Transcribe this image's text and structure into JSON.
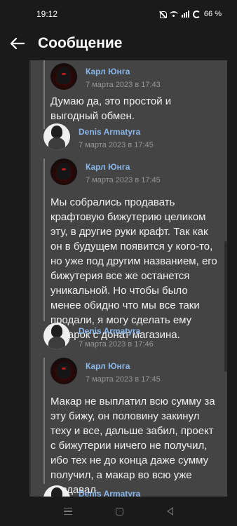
{
  "status_bar": {
    "time": "19:12",
    "battery": "66 %",
    "icons": [
      "bell-off-icon",
      "wifi-icon",
      "signal-icon",
      "battery-icon"
    ]
  },
  "header": {
    "title": "Сообщение",
    "back_icon": "arrow-left-icon"
  },
  "messages": [
    {
      "author": "Карл Юнга",
      "date": "7 марта 2023 в 17:43",
      "text": "Думаю да, это простой и выгодный обмен."
    },
    {
      "author": "Denis Armatyra",
      "date": "7 марта 2023 в 17:45",
      "nested": {
        "author": "Карл Юнга",
        "date": "7 марта 2023 в 17:45",
        "text": "Мы собрались продавать крафтовую бижутерию целиком эту, в другие руки крафт. Так как он в будущем появится у кого-то, но уже под другим названием, его бижутерия все же останется уникальной. Но чтобы было менее обидно что мы все таки продали, я могу сделать ему подарок с донат магазина."
      }
    },
    {
      "author": "Denis Armatyra",
      "date": "7 марта 2023 в 17:46",
      "nested": {
        "author": "Карл Юнга",
        "date": "7 марта 2023 в 17:45",
        "text": "Макар не выплатил всю сумму за эту бижу, он половину закинул теху и все, дальше забил, проект с бижутерии ничего не получил, ибо тех не до конца даже сумму получил, а макар во всю уже раздавал."
      }
    },
    {
      "author": "Denis Armatyra"
    }
  ],
  "nav_bar": {
    "icons": [
      "menu-icon",
      "home-icon",
      "back-triangle-icon"
    ]
  },
  "colors": {
    "background": "#1a1a1a",
    "thread_panel": "#444444",
    "author_link": "#8ab6ea",
    "date_text": "#979797",
    "quote_line": "#7a7a7a"
  }
}
